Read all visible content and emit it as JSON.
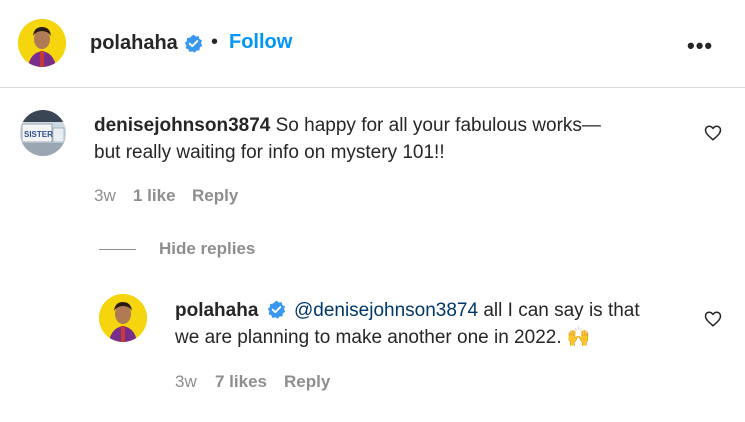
{
  "header": {
    "username": "polahaha",
    "separator": "•",
    "follow_label": "Follow",
    "more_label": "•••"
  },
  "comment": {
    "username": "denisejohnson3874",
    "text_line1": "So happy for all your fabulous works—",
    "text_line2": "but really waiting for info on mystery 101!!",
    "time": "3w",
    "likes": "1 like",
    "reply_label": "Reply",
    "avatar_sign_text": "SISTER"
  },
  "hide_replies_label": "Hide replies",
  "reply": {
    "username": "polahaha",
    "mention": "@denisejohnson3874",
    "text_after_mention": "all I can say is that",
    "text_line2": "we are planning to make another one in 2022.",
    "emoji": "🙌",
    "time": "3w",
    "likes": "7 likes",
    "reply_label": "Reply"
  },
  "colors": {
    "accent": "#0095f6",
    "verified": "#3897f0",
    "avatar_bg": "#f5d50d",
    "muted": "#8e8e8e"
  }
}
